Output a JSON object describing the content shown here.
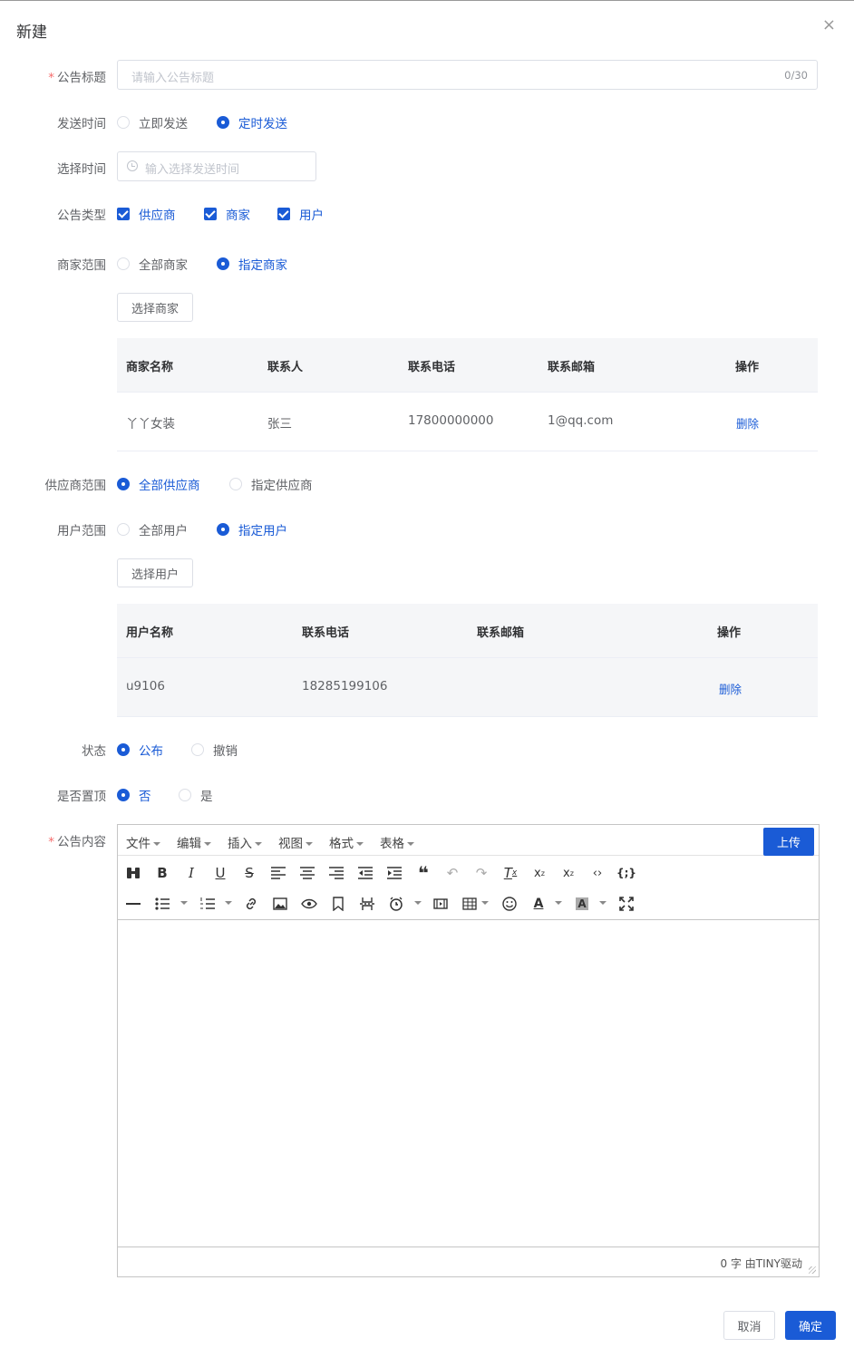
{
  "dialog": {
    "title": "新建",
    "close_glyph": "×"
  },
  "form": {
    "title": {
      "label": "公告标题",
      "required_mark": "*",
      "placeholder": "请输入公告标题",
      "count": "0/30"
    },
    "send_time": {
      "label": "发送时间",
      "options": [
        "立即发送",
        "定时发送"
      ],
      "selected": "定时发送"
    },
    "choose_time": {
      "label": "选择时间",
      "placeholder": "输入选择发送时间"
    },
    "notice_type": {
      "label": "公告类型",
      "options": [
        "供应商",
        "商家",
        "用户"
      ],
      "checked": [
        "供应商",
        "商家",
        "用户"
      ]
    },
    "merchant_scope": {
      "label": "商家范围",
      "options": [
        "全部商家",
        "指定商家"
      ],
      "selected": "指定商家",
      "select_button": "选择商家"
    },
    "merchant_table": {
      "headers": [
        "商家名称",
        "联系人",
        "联系电话",
        "联系邮箱",
        "操作"
      ],
      "rows": [
        {
          "name": "丫丫女装",
          "contact": "张三",
          "phone": "17800000000",
          "email": "1@qq.com",
          "action": "删除"
        }
      ]
    },
    "supplier_scope": {
      "label": "供应商范围",
      "options": [
        "全部供应商",
        "指定供应商"
      ],
      "selected": "全部供应商"
    },
    "user_scope": {
      "label": "用户范围",
      "options": [
        "全部用户",
        "指定用户"
      ],
      "selected": "指定用户",
      "select_button": "选择用户"
    },
    "user_table": {
      "headers": [
        "用户名称",
        "联系电话",
        "联系邮箱",
        "操作"
      ],
      "rows": [
        {
          "name": "u9106",
          "phone": "18285199106",
          "email": "",
          "action": "删除"
        }
      ]
    },
    "status": {
      "label": "状态",
      "options": [
        "公布",
        "撤销"
      ],
      "selected": "公布"
    },
    "pin_top": {
      "label": "是否置顶",
      "options": [
        "否",
        "是"
      ],
      "selected": "否"
    },
    "content": {
      "label": "公告内容",
      "required_mark": "*",
      "menus": [
        "文件",
        "编辑",
        "插入",
        "视图",
        "格式",
        "表格"
      ],
      "upload_label": "上传",
      "status_text": "0 字 由TINY驱动",
      "toolbar_row1": [
        "binoculars-icon",
        "bold-icon",
        "italic-icon",
        "underline-icon",
        "strikethrough-icon",
        "align-left-icon",
        "align-center-icon",
        "align-right-icon",
        "outdent-icon",
        "indent-icon",
        "blockquote-icon",
        "undo-icon",
        "redo-icon",
        "clear-format-icon",
        "subscript-icon",
        "superscript-icon",
        "code-icon",
        "code-block-icon"
      ],
      "toolbar_row2": [
        "horizontal-rule-icon",
        "bullet-list-icon",
        "numbered-list-icon",
        "link-icon",
        "image-icon",
        "preview-icon",
        "bookmark-icon",
        "page-break-icon",
        "clock-icon",
        "media-icon",
        "table-icon",
        "emoji-icon",
        "text-color-icon",
        "background-color-icon",
        "fullscreen-icon"
      ]
    }
  },
  "footer": {
    "cancel": "取消",
    "confirm": "确定"
  },
  "colors": {
    "primary": "#1a5bd6",
    "required": "#f56c6c",
    "header_bg": "#f5f6f8"
  }
}
